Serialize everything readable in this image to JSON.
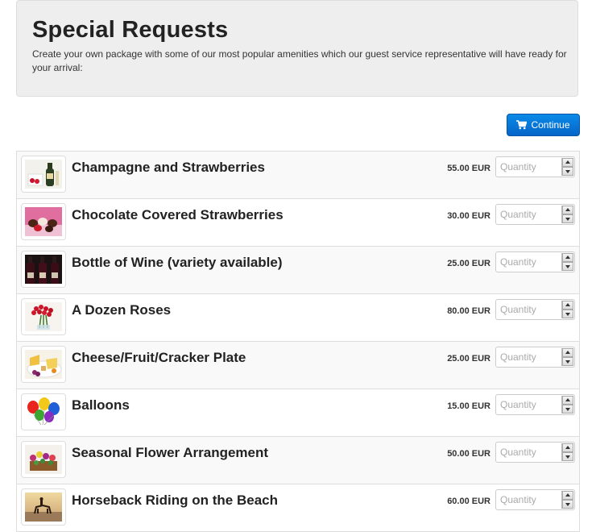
{
  "header": {
    "title": "Special Requests",
    "description": "Create your own package with some of our most popular amenities which our guest service representative will have ready for your arrival:"
  },
  "actions": {
    "continue_label": "Continue",
    "continue_icon": "cart-icon",
    "accent_color": "#0a76d8"
  },
  "items": [
    {
      "name": "Champagne and Strawberries",
      "price": "55.00 EUR",
      "quantity_placeholder": "Quantity",
      "quantity_value": "",
      "thumb": "champagne-strawberries-image"
    },
    {
      "name": "Chocolate Covered Strawberries",
      "price": "30.00 EUR",
      "quantity_placeholder": "Quantity",
      "quantity_value": "",
      "thumb": "chocolate-strawberries-image"
    },
    {
      "name": "Bottle of Wine (variety available)",
      "price": "25.00 EUR",
      "quantity_placeholder": "Quantity",
      "quantity_value": "",
      "thumb": "wine-bottles-image"
    },
    {
      "name": "A Dozen Roses",
      "price": "80.00 EUR",
      "quantity_placeholder": "Quantity",
      "quantity_value": "",
      "thumb": "roses-image"
    },
    {
      "name": "Cheese/Fruit/Cracker Plate",
      "price": "25.00 EUR",
      "quantity_placeholder": "Quantity",
      "quantity_value": "",
      "thumb": "cheese-plate-image"
    },
    {
      "name": "Balloons",
      "price": "15.00 EUR",
      "quantity_placeholder": "Quantity",
      "quantity_value": "",
      "thumb": "balloons-image"
    },
    {
      "name": "Seasonal Flower Arrangement",
      "price": "50.00 EUR",
      "quantity_placeholder": "Quantity",
      "quantity_value": "",
      "thumb": "flower-arrangement-image"
    },
    {
      "name": "Horseback Riding on the Beach",
      "price": "60.00 EUR",
      "quantity_placeholder": "Quantity",
      "quantity_value": "",
      "thumb": "horseback-beach-image"
    }
  ]
}
